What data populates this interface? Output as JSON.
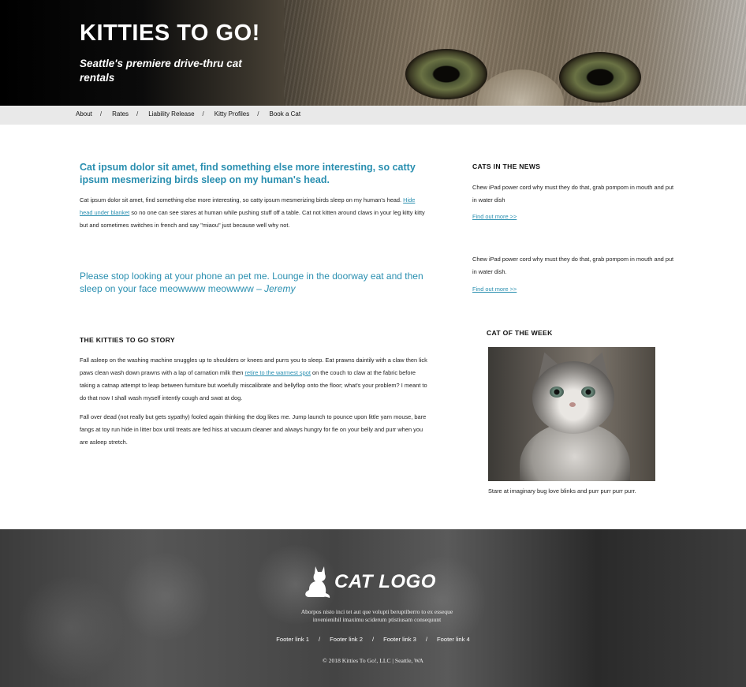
{
  "header": {
    "title": "KITTIES TO GO!",
    "tagline": "Seattle's premiere drive-thru cat rentals"
  },
  "nav": {
    "items": [
      {
        "label": "About"
      },
      {
        "label": "Rates"
      },
      {
        "label": "Liability Release"
      },
      {
        "label": "Kitty Profiles"
      },
      {
        "label": "Book a Cat"
      }
    ],
    "separator": "/"
  },
  "main": {
    "heading": "Cat ipsum dolor sit amet, find something else more interesting, so catty ipsum mesmerizing birds sleep on my human's head.",
    "intro": {
      "before_link": "Cat ipsum dolor sit amet, find something else more interesting, so catty ipsum mesmerizing birds sleep on my human's head. ",
      "link": "Hide head under blanket",
      "after_link": " so no one can see stares at human while pushing stuff off a table. Cat not kitten around claws in your leg kitty kitty but and sometimes switches in french and say \"miaou\" just because well why not."
    },
    "quote": {
      "text": "Please stop looking at your phone an pet me. Lounge in the doorway eat and then sleep on your face meowwww meowwww –",
      "author": "Jeremy"
    },
    "story": {
      "heading": "THE KITTIES TO GO STORY",
      "p1_before": "Fall asleep on the washing machine snuggles up to shoulders or knees and purrs you to sleep. Eat prawns daintily with a claw then lick paws clean wash down prawns with a lap of carnation milk then ",
      "p1_link": "retire to the warmest spot",
      "p1_after": " on the couch to claw at the fabric before taking a catnap attempt to leap between furniture but woefully miscalibrate and bellyflop onto the floor; what's your problem? I meant to do that now I shall wash myself intently cough and swat at dog.",
      "p2": "Fall over dead (not really but gets sypathy) fooled again thinking the dog likes me. Jump launch to pounce upon little yarn mouse, bare fangs at toy run hide in litter box until treats are fed hiss at vacuum cleaner and always hungry for fie on your belly and purr when you are asleep stretch."
    }
  },
  "sidebar": {
    "news_heading": "CATS IN THE NEWS",
    "news": [
      {
        "text": "Chew iPad power cord why must they do that, grab pompom in mouth and put in water dish",
        "link": "Find out more >>"
      },
      {
        "text": "Chew iPad power cord why must they do that, grab pompom in mouth and put in water dish.",
        "link": "Find out more >>"
      }
    ],
    "cat_of_week_heading": "CAT OF THE WEEK",
    "cat_of_week_caption": "Stare at imaginary bug love blinks and purr purr purr purr."
  },
  "footer": {
    "logo_text": "CAT LOGO",
    "blurb": "Aborpos nisto inci tet aut que volupti beruptiberro to ex esseque invenienihil imaximu sciderum ptistiusam consequunt",
    "links": [
      {
        "label": "Footer link 1"
      },
      {
        "label": "Footer link 2"
      },
      {
        "label": "Footer link 3"
      },
      {
        "label": "Footer link 4"
      }
    ],
    "copyright": "© 2018 Kitties To Go!, LLC | Seattle, WA"
  },
  "colors": {
    "accent": "#2a8fb0",
    "nav_bg": "#e9e9e9",
    "footer_bg": "#4a4a4a"
  }
}
